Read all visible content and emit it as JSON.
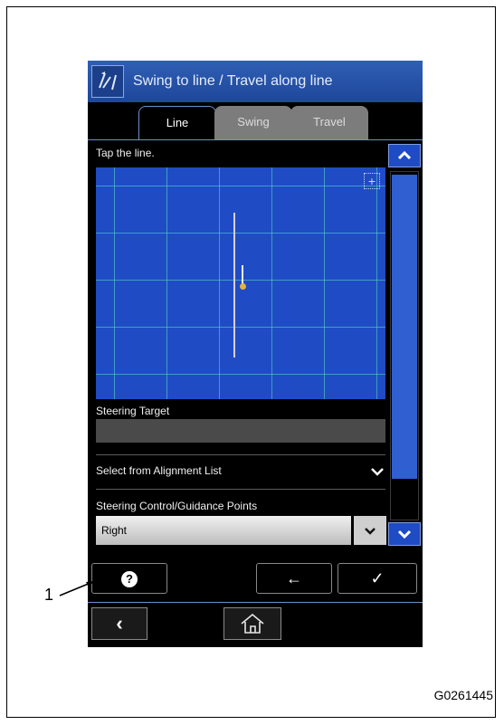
{
  "window": {
    "title": "Swing to line / Travel along line",
    "title_icon": "line-guidance-icon"
  },
  "tabs": [
    {
      "label": "Line",
      "active": true
    },
    {
      "label": "Swing",
      "active": false
    },
    {
      "label": "Travel",
      "active": false
    }
  ],
  "main": {
    "prompt": "Tap the line.",
    "steering_target_label": "Steering Target",
    "steering_target_value": "",
    "alignment_list_label": "Select from Alignment List",
    "guidance_points_label": "Steering Control/Guidance Points",
    "guidance_points_value": "Right"
  },
  "buttons": {
    "help": "?",
    "back": "←",
    "ok": "✓"
  },
  "nav": {
    "back": "‹",
    "home": "home-icon"
  },
  "annotation": {
    "callout_number": "1"
  },
  "figure_code": "G0261445",
  "colors": {
    "title_bar": "#2555ad",
    "map_bg": "#1f4cc4",
    "grid": "#5adcc8",
    "scroll_thumb": "#2f5fd0"
  }
}
